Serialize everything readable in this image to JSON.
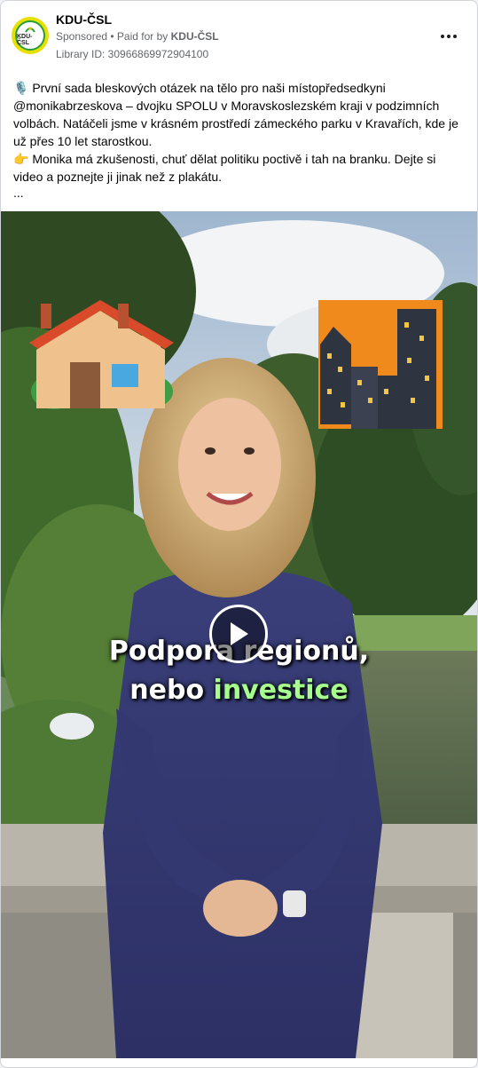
{
  "header": {
    "page_name": "KDU-ČSL",
    "sponsored": "Sponsored",
    "separator": " • ",
    "paid_prefix": "Paid for by ",
    "paid_by": "KDU-ČSL",
    "library_id": "Library ID: 30966869972904100",
    "avatar_text": "KDU-ČSL"
  },
  "post": {
    "line1": "🎙️ První sada bleskových otázek na tělo pro naši místopředsedkyni @monikabrzeskova – dvojku SPOLU v Moravskoslezském kraji v podzimních volbách. Natáčeli jsme v krásném prostředí zámeckého parku v Kravařích, kde je už přes 10 let starostkou.",
    "line2": "👉 Monika má zkušenosti, chuť dělat politiku poctivě i tah na branku. Dejte si video a poznejte ji jinak než z plakátu.",
    "ellipsis": "..."
  },
  "video": {
    "caption_line1": "Podpora regionů,",
    "caption_line2_prefix": "nebo ",
    "caption_line2_highlight": "investice",
    "left_emoji": "house-emoji",
    "right_emoji": "city-emoji"
  },
  "colors": {
    "caption_highlight": "#a6ff8c",
    "avatar_yellow": "#e8e000",
    "avatar_green": "#2a9d3a"
  }
}
